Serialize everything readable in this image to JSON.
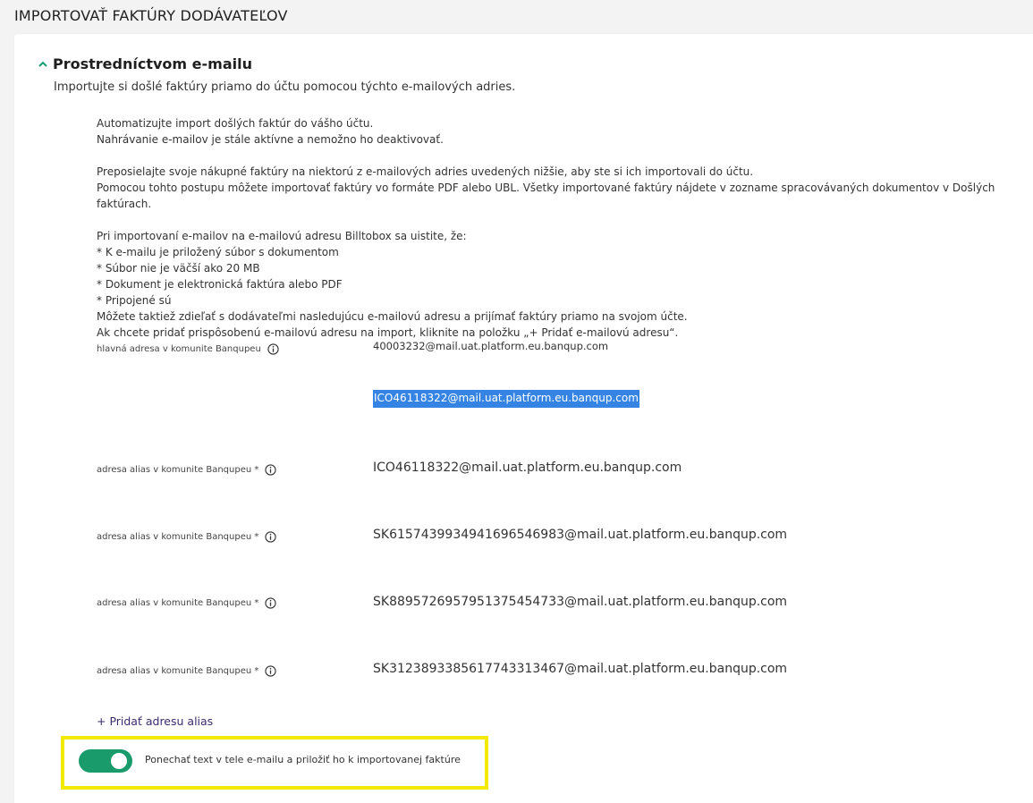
{
  "page": {
    "title": "IMPORTOVAŤ FAKTÚRY DODÁVATEĽOV"
  },
  "section": {
    "title": "Prostredníctvom e-mailu",
    "description": "Importujte si došlé faktúry priamo do účtu pomocou týchto e-mailových adries.",
    "info_lines": [
      "Automatizujte import došlých faktúr do vášho účtu.",
      "Nahrávanie e-mailov je stále aktívne a nemožno ho deaktivovať.",
      "",
      "Preposielajte svoje nákupné faktúry na niektorú z e-mailových adries uvedených nižšie, aby ste si ich importovali do účtu.",
      "Pomocou tohto postupu môžete importovať faktúry vo formáte PDF alebo UBL. Všetky importované faktúry nájdete v zozname spracovávaných dokumentov v Došlých faktúrach.",
      "",
      "Pri importovaní e-mailov na e-mailovú adresu Billtobox sa uistite, že:",
      "* K e-mailu je priložený súbor s dokumentom",
      "* Súbor nie je väčší ako 20 MB",
      "* Dokument je elektronická faktúra alebo PDF",
      "* Pripojené sú",
      "Môžete taktiež zdieľať s dodávateľmi nasledujúcu e-mailovú adresu a prijímať faktúry priamo na svojom účte.",
      "Ak chcete pridať prispôsobenú e-mailovú adresu na import, kliknite na položku „+ Pridať e-mailovú adresu“."
    ]
  },
  "main_address": {
    "label": "hlavná adresa v komunite Banqupeu",
    "value": "40003232@mail.uat.platform.eu.banqup.com",
    "selected_value": "ICO46118322@mail.uat.platform.eu.banqup.com"
  },
  "aliases": [
    {
      "label": "adresa alias v komunite Banqupeu *",
      "value": "ICO46118322@mail.uat.platform.eu.banqup.com"
    },
    {
      "label": "adresa alias v komunite Banqupeu *",
      "value": "SK6157439934941696546983@mail.uat.platform.eu.banqup.com"
    },
    {
      "label": "adresa alias v komunite Banqupeu *",
      "value": "SK8895726957951375454733@mail.uat.platform.eu.banqup.com"
    },
    {
      "label": "adresa alias v komunite Banqupeu *",
      "value": "SK3123893385617743313467@mail.uat.platform.eu.banqup.com"
    }
  ],
  "add_alias_label": "+ Pridať adresu alias",
  "toggle": {
    "label": "Ponechať text v tele e-mailu a priložiť ho k importovanej faktúre",
    "on": true,
    "on_color": "#1a9b6b"
  },
  "highlight_color": "#f2ea00",
  "icons": {
    "section_toggle": "chevron-up-icon",
    "info": "info-icon"
  }
}
